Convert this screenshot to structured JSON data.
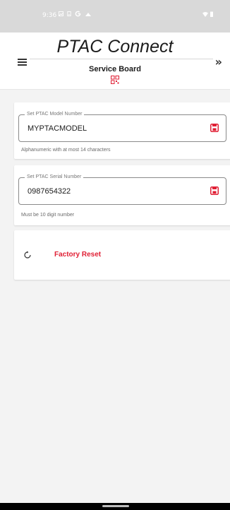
{
  "status_bar": {
    "time": "9:36",
    "left_icons": [
      "gallery-icon",
      "storage-icon",
      "google-icon",
      "cloud-icon"
    ],
    "right_icons": [
      "wifi-icon",
      "battery-icon"
    ]
  },
  "header": {
    "title": "PTAC Connect",
    "subtitle": "Service Board",
    "menu_icon": "hamburger-icon",
    "next_icon": "double-chevron-right-icon",
    "next_glyph": "»",
    "board_icon": "qr-code-icon"
  },
  "model_card": {
    "legend": "Set PTAC Model Number",
    "value": "MYPTACMODEL",
    "helper": "Alphanumeric with at most 14 characters",
    "save_icon": "save-icon"
  },
  "serial_card": {
    "legend": "Set PTAC Serial Number",
    "value": "0987654322",
    "helper": "Must be 10 digit number",
    "save_icon": "save-icon"
  },
  "reset_card": {
    "icon": "refresh-icon",
    "label": "Factory Reset"
  },
  "colors": {
    "accent": "#e01f34",
    "status_bar": "#d9d9d9",
    "background": "#f3f3f3"
  }
}
